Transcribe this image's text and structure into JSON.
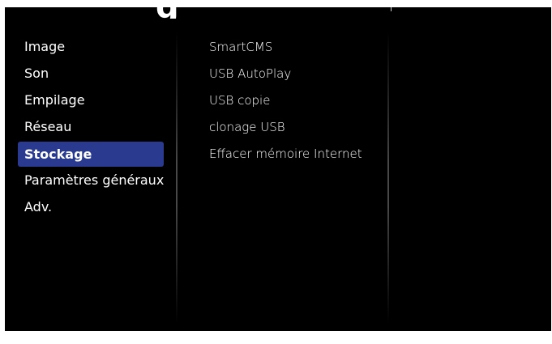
{
  "left_menu": {
    "items": [
      {
        "label": "Image"
      },
      {
        "label": "Son"
      },
      {
        "label": "Empilage"
      },
      {
        "label": "Réseau"
      },
      {
        "label": "Stockage",
        "selected": true
      },
      {
        "label": "Paramètres généraux"
      },
      {
        "label": "Adv."
      }
    ]
  },
  "right_menu": {
    "items": [
      {
        "label": "SmartCMS"
      },
      {
        "label": "USB AutoPlay"
      },
      {
        "label": "USB copie"
      },
      {
        "label": "clonage USB"
      },
      {
        "label": "Effacer mémoire Internet"
      }
    ]
  },
  "colors": {
    "background": "#000000",
    "selected_highlight": "#2a3a8f",
    "text": "#ffffff"
  }
}
